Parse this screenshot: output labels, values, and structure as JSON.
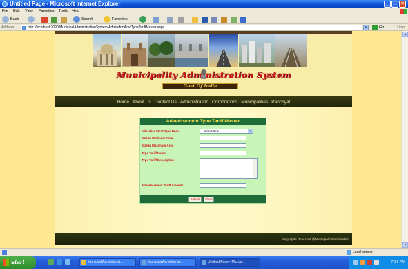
{
  "window": {
    "title": "Untitled Page - Microsoft Internet Explorer"
  },
  "menu": [
    "File",
    "Edit",
    "View",
    "Favorites",
    "Tools",
    "Help"
  ],
  "toolbar": {
    "back": "Back",
    "search": "Search",
    "favorites": "Favorites"
  },
  "address": {
    "label": "Address",
    "url": "http://localhost:2090/MunicipalAdministrationSystem/Admin/frmAdvtTypeTariffMaster.aspx",
    "go": "Go",
    "links": "Links"
  },
  "site": {
    "title": "Municipality Administration System",
    "subtitle": "Govt Of India",
    "nav": [
      "Home",
      "About Us",
      "Contact Us",
      "Administration",
      "Corporations",
      "Municipalities",
      "Panchyat"
    ],
    "footer": "Copyrights Reserved @Municipal Administration"
  },
  "form": {
    "title": "Advertisement Type Tariff Master",
    "fields": {
      "heading_type": "Advertise Ment Type Name",
      "heading_type_value": "--Select One--",
      "min_area": "Size In Minimum Area",
      "max_area": "Size In Maximum Area",
      "tariff_name": "Type Tariff Name",
      "tariff_desc": "Type Tariff Description",
      "tariff_amount": "Advertisement Tariff Amount"
    },
    "submit": "Submit",
    "clear": "Clear"
  },
  "status": {
    "zone": "Local intranet"
  },
  "taskbar": {
    "start": "start",
    "tasks": [
      "MunicipalAdministrati...",
      "MunicipalAdministrati...",
      "Untitled Page - Micros..."
    ],
    "clock": "7:27 PM"
  },
  "colors": {
    "form_header": "#1e6b3a",
    "form_title": "#ffe34d",
    "label_red": "#d60f0f",
    "page_bg": "#fde791",
    "nav_bg": "#2a2f0e"
  }
}
